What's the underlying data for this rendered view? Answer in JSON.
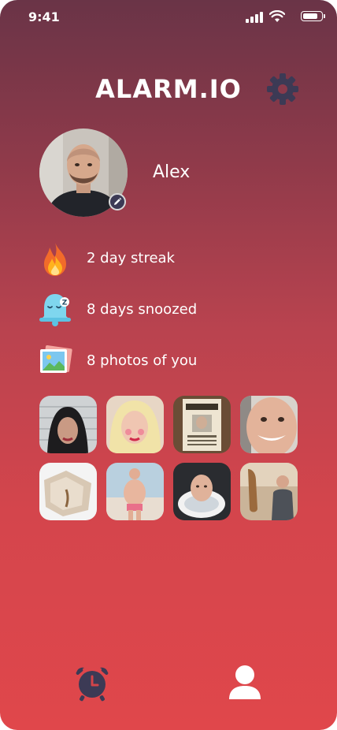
{
  "status_bar": {
    "time": "9:41"
  },
  "header": {
    "title": "ALARM.IO",
    "settings_icon": "gear-icon"
  },
  "profile": {
    "name": "Alex",
    "edit_icon": "pencil-icon"
  },
  "stats": [
    {
      "icon": "fire-icon",
      "label": "2 day streak"
    },
    {
      "icon": "snoozing-bell-icon",
      "label": "8 days snoozed"
    },
    {
      "icon": "photos-icon",
      "label": "8 photos of you"
    }
  ],
  "photos_count": 8,
  "tab_bar": {
    "items": [
      "alarm-clock-icon",
      "user-icon"
    ]
  },
  "colors": {
    "gradient_top": "#6a3447",
    "gradient_bottom": "#e0474b",
    "icon_dark": "#3c3a55"
  }
}
